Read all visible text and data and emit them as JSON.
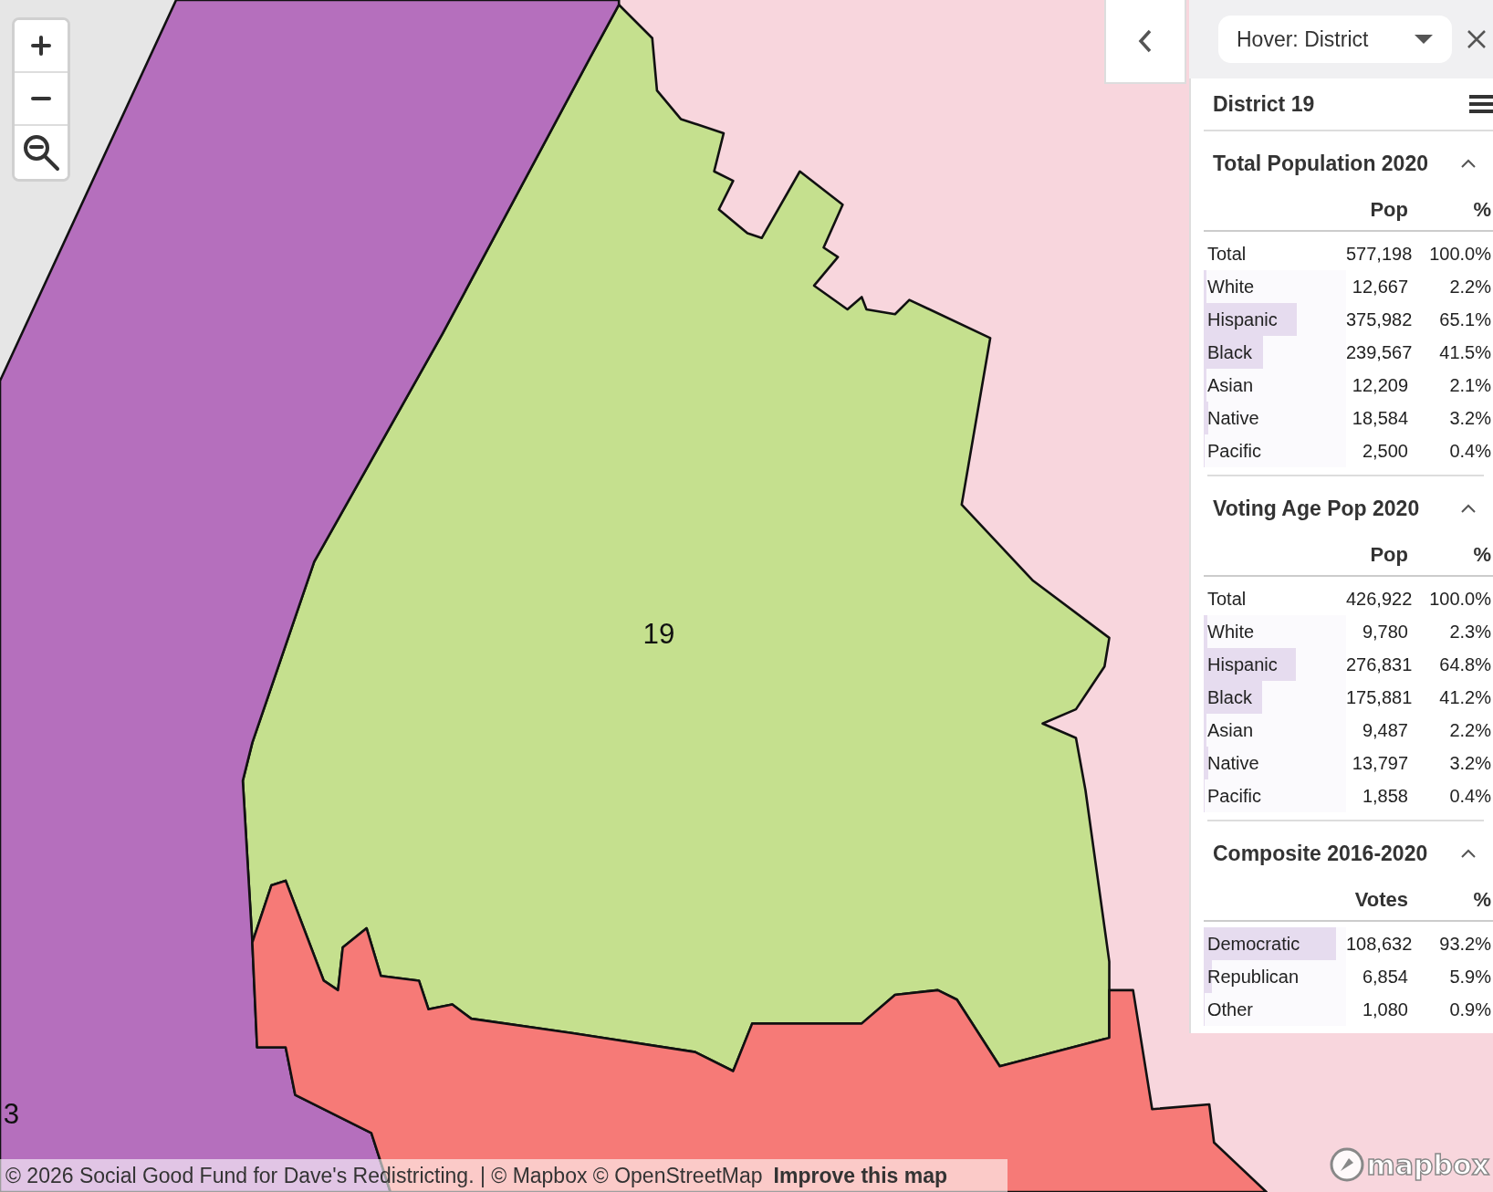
{
  "map": {
    "districts": [
      {
        "label": "19",
        "color": "#c5e08e"
      },
      {
        "label": "3",
        "color": "#b56fbd"
      },
      {
        "color": "#f67a77"
      }
    ],
    "attribution": {
      "text": "© 2026 Social Good Fund for Dave's Redistricting. | © Mapbox © OpenStreetMap",
      "link": "Improve this map"
    },
    "logo": "mapbox"
  },
  "panel": {
    "hover_select": {
      "value": "Hover: District"
    },
    "title": "District 19",
    "sections": [
      {
        "title": "Total Population 2020",
        "expanded": true,
        "columns": [
          "Pop",
          "%"
        ],
        "rows": [
          {
            "name": "Total",
            "value": "577,198",
            "pct": "100.0%"
          },
          {
            "name": "White",
            "value": "12,667",
            "pct": "2.2%",
            "level": 0.022
          },
          {
            "name": "Hispanic",
            "value": "375,982",
            "pct": "65.1%",
            "level": 0.651
          },
          {
            "name": "Black",
            "value": "239,567",
            "pct": "41.5%",
            "level": 0.415
          },
          {
            "name": "Asian",
            "value": "12,209",
            "pct": "2.1%",
            "level": 0.021
          },
          {
            "name": "Native",
            "value": "18,584",
            "pct": "3.2%",
            "level": 0.032
          },
          {
            "name": "Pacific",
            "value": "2,500",
            "pct": "0.4%",
            "level": 0.004
          }
        ]
      },
      {
        "title": "Voting Age Pop 2020",
        "expanded": true,
        "columns": [
          "Pop",
          "%"
        ],
        "rows": [
          {
            "name": "Total",
            "value": "426,922",
            "pct": "100.0%"
          },
          {
            "name": "White",
            "value": "9,780",
            "pct": "2.3%",
            "level": 0.023
          },
          {
            "name": "Hispanic",
            "value": "276,831",
            "pct": "64.8%",
            "level": 0.648
          },
          {
            "name": "Black",
            "value": "175,881",
            "pct": "41.2%",
            "level": 0.412
          },
          {
            "name": "Asian",
            "value": "9,487",
            "pct": "2.2%",
            "level": 0.022
          },
          {
            "name": "Native",
            "value": "13,797",
            "pct": "3.2%",
            "level": 0.032
          },
          {
            "name": "Pacific",
            "value": "1,858",
            "pct": "0.4%",
            "level": 0.004
          }
        ]
      },
      {
        "title": "Composite 2016-2020",
        "expanded": true,
        "columns": [
          "Votes",
          "%"
        ],
        "rows": [
          {
            "name": "Democratic",
            "value": "108,632",
            "pct": "93.2%",
            "level": 0.932
          },
          {
            "name": "Republican",
            "value": "6,854",
            "pct": "5.9%",
            "level": 0.059
          },
          {
            "name": "Other",
            "value": "1,080",
            "pct": "0.9%",
            "level": 0.009
          }
        ]
      }
    ]
  }
}
